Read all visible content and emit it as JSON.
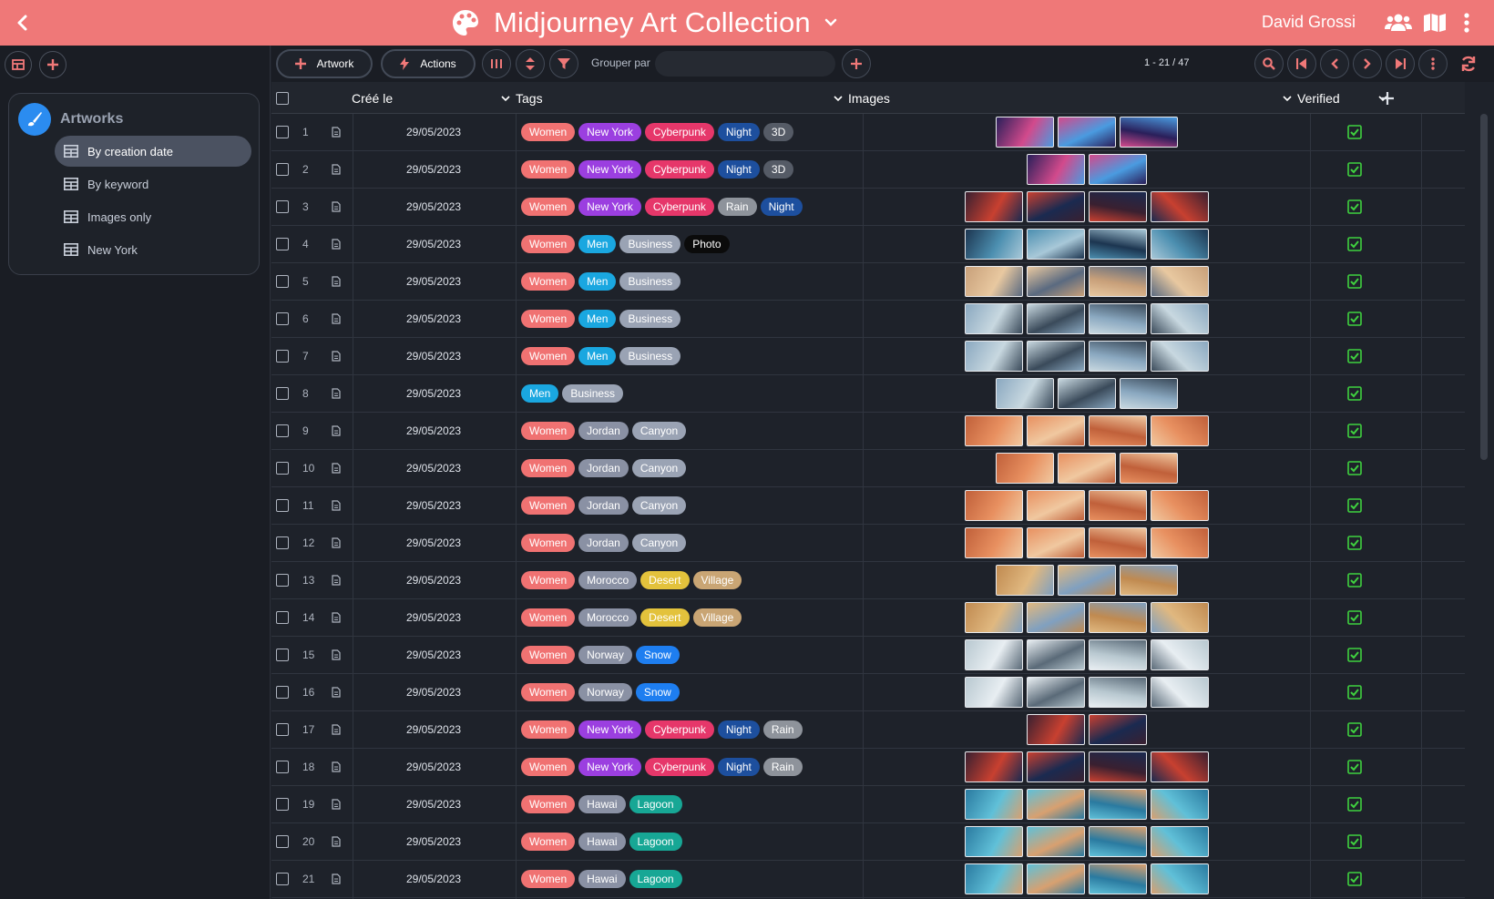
{
  "header": {
    "title": "Midjourney Art Collection",
    "user_name": "David Grossi",
    "icons": [
      "back-icon",
      "palette-icon",
      "chevron-down-icon",
      "users-icon",
      "map-icon",
      "more-vertical-icon"
    ],
    "background_color": "#ef7878"
  },
  "sidebar": {
    "panel_title": "Artworks",
    "items": [
      {
        "label": "By creation date",
        "active": true
      },
      {
        "label": "By keyword",
        "active": false
      },
      {
        "label": "Images only",
        "active": false
      },
      {
        "label": "New York",
        "active": false
      }
    ]
  },
  "toolbar": {
    "artwork_label": "Artwork",
    "actions_label": "Actions",
    "grouper_label": "Grouper par",
    "grouper_value": "",
    "pagination": "1 - 21 / 47"
  },
  "grid": {
    "columns": {
      "created": "Créé le",
      "tags": "Tags",
      "images": "Images",
      "verified": "Verified"
    },
    "tag_colors": {
      "Women": "#f07272",
      "New York": "#9b3fe0",
      "Cyberpunk": "#e6376a",
      "Night": "#1d4f9e",
      "3D": "#555b66",
      "Rain": "#8e939b",
      "Men": "#1aa7e0",
      "Business": "#9aa3b4",
      "Photo": "#0b0b0b",
      "Jordan": "#8a91a4",
      "Canyon": "#9aa3b4",
      "Morocco": "#8a91a4",
      "Desert": "#e3c23c",
      "Village": "#c9a574",
      "Norway": "#8a91a4",
      "Snow": "#1e7ef0",
      "Hawai": "#8a91a4",
      "Lagoon": "#17a795"
    },
    "image_palettes": {
      "cyber": [
        "#2a1f5a",
        "#d24a8c",
        "#4a9be0"
      ],
      "business_dark": [
        "#1c3550",
        "#4c8fb0",
        "#a8c8d8"
      ],
      "business_warm": [
        "#c8a07a",
        "#e8c8a0",
        "#5a6a80"
      ],
      "business_cool": [
        "#8aa8c0",
        "#c8d8e0",
        "#3a4a5a"
      ],
      "canyon": [
        "#c0603a",
        "#e89060",
        "#f0c8a0"
      ],
      "desert": [
        "#c08a50",
        "#e0b880",
        "#80a0c0"
      ],
      "snow": [
        "#b8c8d0",
        "#e8eef2",
        "#5a6a78"
      ],
      "lagoon": [
        "#2a7aa0",
        "#60c0d8",
        "#d8a070"
      ],
      "night_city": [
        "#3a2030",
        "#c84030",
        "#1a2a50"
      ]
    },
    "rows": [
      {
        "num": "1",
        "date": "29/05/2023",
        "tags": [
          "Women",
          "New York",
          "Cyberpunk",
          "Night",
          "3D"
        ],
        "images": 3,
        "palette": "cyber",
        "verified": true
      },
      {
        "num": "2",
        "date": "29/05/2023",
        "tags": [
          "Women",
          "New York",
          "Cyberpunk",
          "Night",
          "3D"
        ],
        "images": 2,
        "palette": "cyber",
        "verified": true
      },
      {
        "num": "3",
        "date": "29/05/2023",
        "tags": [
          "Women",
          "New York",
          "Cyberpunk",
          "Rain",
          "Night"
        ],
        "images": 4,
        "palette": "night_city",
        "verified": true
      },
      {
        "num": "4",
        "date": "29/05/2023",
        "tags": [
          "Women",
          "Men",
          "Business",
          "Photo"
        ],
        "images": 4,
        "palette": "business_dark",
        "verified": true
      },
      {
        "num": "5",
        "date": "29/05/2023",
        "tags": [
          "Women",
          "Men",
          "Business"
        ],
        "images": 4,
        "palette": "business_warm",
        "verified": true
      },
      {
        "num": "6",
        "date": "29/05/2023",
        "tags": [
          "Women",
          "Men",
          "Business"
        ],
        "images": 4,
        "palette": "business_cool",
        "verified": true
      },
      {
        "num": "7",
        "date": "29/05/2023",
        "tags": [
          "Women",
          "Men",
          "Business"
        ],
        "images": 4,
        "palette": "business_cool",
        "verified": true
      },
      {
        "num": "8",
        "date": "29/05/2023",
        "tags": [
          "Men",
          "Business"
        ],
        "images": 3,
        "palette": "business_cool",
        "verified": true
      },
      {
        "num": "9",
        "date": "29/05/2023",
        "tags": [
          "Women",
          "Jordan",
          "Canyon"
        ],
        "images": 4,
        "palette": "canyon",
        "verified": true
      },
      {
        "num": "10",
        "date": "29/05/2023",
        "tags": [
          "Women",
          "Jordan",
          "Canyon"
        ],
        "images": 3,
        "palette": "canyon",
        "verified": true
      },
      {
        "num": "11",
        "date": "29/05/2023",
        "tags": [
          "Women",
          "Jordan",
          "Canyon"
        ],
        "images": 4,
        "palette": "canyon",
        "verified": true
      },
      {
        "num": "12",
        "date": "29/05/2023",
        "tags": [
          "Women",
          "Jordan",
          "Canyon"
        ],
        "images": 4,
        "palette": "canyon",
        "verified": true
      },
      {
        "num": "13",
        "date": "29/05/2023",
        "tags": [
          "Women",
          "Morocco",
          "Desert",
          "Village"
        ],
        "images": 3,
        "palette": "desert",
        "verified": true
      },
      {
        "num": "14",
        "date": "29/05/2023",
        "tags": [
          "Women",
          "Morocco",
          "Desert",
          "Village"
        ],
        "images": 4,
        "palette": "desert",
        "verified": true
      },
      {
        "num": "15",
        "date": "29/05/2023",
        "tags": [
          "Women",
          "Norway",
          "Snow"
        ],
        "images": 4,
        "palette": "snow",
        "verified": true
      },
      {
        "num": "16",
        "date": "29/05/2023",
        "tags": [
          "Women",
          "Norway",
          "Snow"
        ],
        "images": 4,
        "palette": "snow",
        "verified": true
      },
      {
        "num": "17",
        "date": "29/05/2023",
        "tags": [
          "Women",
          "New York",
          "Cyberpunk",
          "Night",
          "Rain"
        ],
        "images": 2,
        "palette": "night_city",
        "verified": true
      },
      {
        "num": "18",
        "date": "29/05/2023",
        "tags": [
          "Women",
          "New York",
          "Cyberpunk",
          "Night",
          "Rain"
        ],
        "images": 4,
        "palette": "night_city",
        "verified": true
      },
      {
        "num": "19",
        "date": "29/05/2023",
        "tags": [
          "Women",
          "Hawai",
          "Lagoon"
        ],
        "images": 4,
        "palette": "lagoon",
        "verified": true
      },
      {
        "num": "20",
        "date": "29/05/2023",
        "tags": [
          "Women",
          "Hawai",
          "Lagoon"
        ],
        "images": 4,
        "palette": "lagoon",
        "verified": true
      },
      {
        "num": "21",
        "date": "29/05/2023",
        "tags": [
          "Women",
          "Hawai",
          "Lagoon"
        ],
        "images": 4,
        "palette": "lagoon",
        "verified": true
      }
    ]
  }
}
